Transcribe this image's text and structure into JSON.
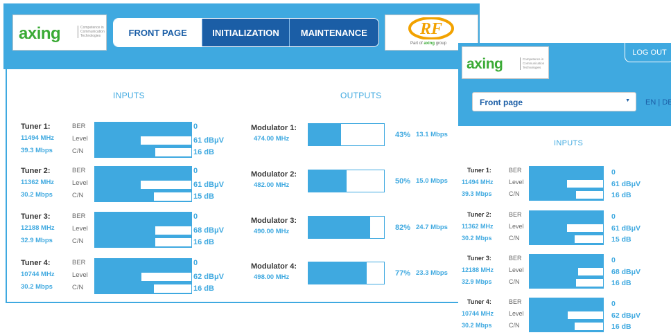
{
  "brand": {
    "logo_word": "axing",
    "logo_tagline": "Competence in Communication Technologies",
    "partner_mark": "RF",
    "partner_line_prefix": "Part of",
    "partner_line_brand": "axing",
    "partner_line_suffix": "group"
  },
  "nav": {
    "tabs": [
      {
        "label": "FRONT PAGE",
        "active": true
      },
      {
        "label": "INITIALIZATION",
        "active": false
      },
      {
        "label": "MAINTENANCE",
        "active": false
      }
    ]
  },
  "sections": {
    "inputs": "INPUTS",
    "outputs": "OUTPUTS"
  },
  "labels": {
    "ber": "BER",
    "level": "Level",
    "cn": "C/N"
  },
  "tuners": [
    {
      "name": "Tuner 1:",
      "freq": "11494 MHz",
      "rate": "39.3 Mbps",
      "ber": "0",
      "level": "61 dBμV",
      "cn": "16 dB",
      "ber_fill": 0.82,
      "level_fill": 0.63,
      "cn_fill": 0.62
    },
    {
      "name": "Tuner 2:",
      "freq": "11362 MHz",
      "rate": "30.2 Mbps",
      "ber": "0",
      "level": "61 dBμV",
      "cn": "15 dB",
      "ber_fill": 0.82,
      "level_fill": 0.63,
      "cn_fill": 0.6
    },
    {
      "name": "Tuner 3:",
      "freq": "12188 MHz",
      "rate": "32.9 Mbps",
      "ber": "0",
      "level": "68 dBμV",
      "cn": "16 dB",
      "ber_fill": 0.82,
      "level_fill": 0.78,
      "cn_fill": 0.62
    },
    {
      "name": "Tuner 4:",
      "freq": "10744 MHz",
      "rate": "30.2 Mbps",
      "ber": "0",
      "level": "62 dBμV",
      "cn": "16 dB",
      "ber_fill": 0.82,
      "level_fill": 0.64,
      "cn_fill": 0.6
    }
  ],
  "modulators": [
    {
      "name": "Modulator 1:",
      "freq": "474.00 MHz",
      "percent": "43%",
      "rate": "13.1 Mbps",
      "fill": 0.43
    },
    {
      "name": "Modulator 2:",
      "freq": "482.00 MHz",
      "percent": "50%",
      "rate": "15.0 Mbps",
      "fill": 0.5
    },
    {
      "name": "Modulator 3:",
      "freq": "490.00 MHz",
      "percent": "82%",
      "rate": "24.7 Mbps",
      "fill": 0.82
    },
    {
      "name": "Modulator 4:",
      "freq": "498.00 MHz",
      "percent": "77%",
      "rate": "23.3 Mbps",
      "fill": 0.77
    }
  ],
  "mobile": {
    "logout_label": "LOG OUT",
    "page_select_value": "Front page",
    "lang_en": "EN",
    "lang_sep": " | ",
    "lang_de": "DE"
  },
  "colors": {
    "accent": "#3fa9e0",
    "nav_dark": "#1b5ea6",
    "logo_green": "#3aaa35",
    "rf_orange": "#f2a200"
  }
}
